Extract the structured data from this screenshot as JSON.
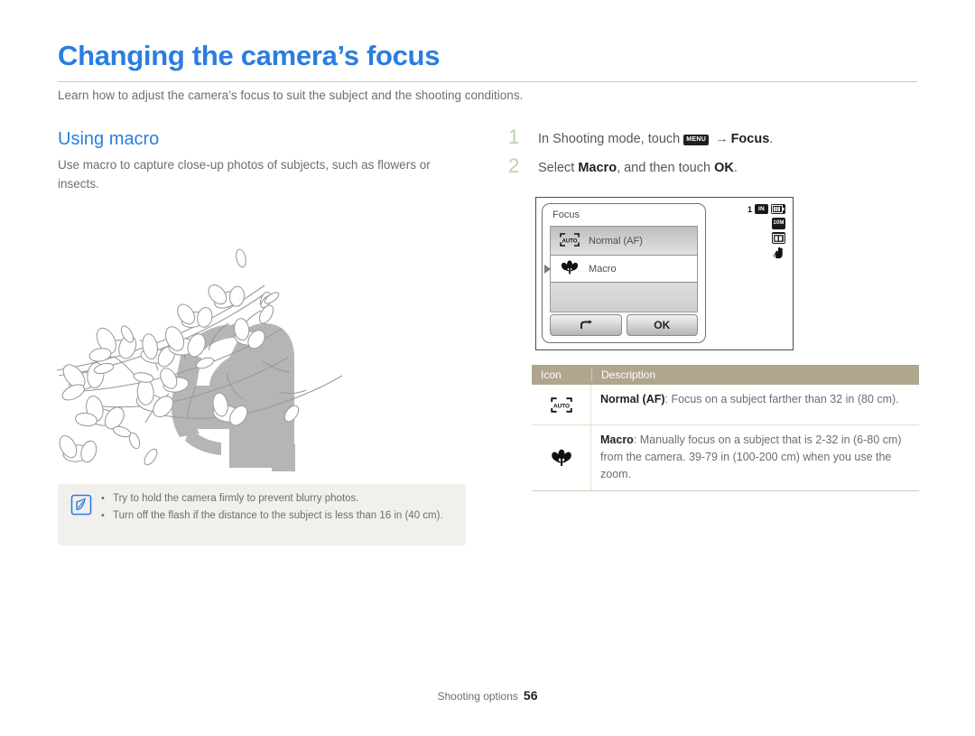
{
  "document": {
    "title": "Changing the camera’s focus",
    "intro": "Learn how to adjust the camera’s focus to suit the subject and the shooting conditions.",
    "section_heading": "Using macro",
    "left_paragraph": "Use macro to capture close-up photos of subjects, such as flowers or insects."
  },
  "colors": {
    "title_blue": "#2a7de1",
    "heading_blue": "#2a7de1",
    "table_header_bg": "#b0a68e",
    "note_bg": "#f2f0ec",
    "step_number": "#bcd3a7",
    "body_text": "#6d6e71"
  },
  "note": {
    "icon": "note-pen-icon",
    "items": [
      "Try to hold the camera firmly to prevent blurry photos.",
      "Turn off the flash if the distance to the subject is less than 16 in (40 cm)."
    ]
  },
  "steps": [
    {
      "number": "1",
      "pre": "In Shooting mode, touch",
      "chip": "MENU",
      "arrow": "→",
      "bold": "Focus",
      "post": "."
    },
    {
      "number": "2",
      "pre": "Select",
      "bold": "Macro",
      "mid": ", and then touch",
      "ok": "OK",
      "post": "."
    }
  ],
  "camera_screen": {
    "dialog_title": "Focus",
    "options": [
      {
        "icon": "auto-focus-icon",
        "label": "Normal (AF)",
        "selected": false
      },
      {
        "icon": "macro-flower-icon",
        "label": "Macro",
        "selected": true
      }
    ],
    "buttons": [
      {
        "name": "back",
        "label": "↩"
      },
      {
        "name": "ok",
        "label": "OK"
      }
    ],
    "status": {
      "shots_remaining": "1",
      "memory": "IN",
      "battery": "battery-full-icon",
      "resolution": "10M",
      "face_detect": "face-detect-icon",
      "stabilizer": "hand-shake-icon"
    }
  },
  "table": {
    "headers": [
      "Icon",
      "Description"
    ],
    "rows": [
      {
        "icon": "auto-focus-icon",
        "term": "Normal (AF)",
        "description": ": Focus on a subject farther than 32 in (80 cm)."
      },
      {
        "icon": "macro-flower-icon",
        "term": "Macro",
        "description": ": Manually focus on a subject that is 2-32 in (6-80 cm) from the camera. 39-79 in (100-200 cm) when you use the zoom."
      }
    ]
  },
  "footer": {
    "section": "Shooting options",
    "page_number": "56"
  }
}
